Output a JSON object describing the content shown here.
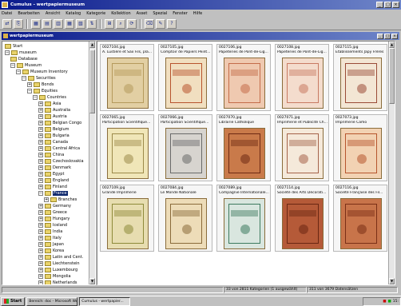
{
  "window": {
    "title": "Cumulus - wertpapiermuseum",
    "min": "_",
    "max": "□",
    "close": "×"
  },
  "menu": [
    "Datei",
    "Bearbeiten",
    "Ansicht",
    "Katalog",
    "Kategorie",
    "Kollektion",
    "Asset",
    "Spezial",
    "Fenster",
    "Hilfe"
  ],
  "toolbar": [
    "⇄",
    "⎘",
    "▦",
    "▤",
    "▥",
    "▦",
    "▧",
    "⇅",
    "⊞",
    "⌕",
    "⟳",
    "⌫",
    "✎",
    "?"
  ],
  "subwindow": {
    "title": "wertpapiermuseum"
  },
  "tree": [
    {
      "label": "Start",
      "depth": 0,
      "exp": ""
    },
    {
      "label": "museum",
      "depth": 0,
      "exp": "−"
    },
    {
      "label": "Database",
      "depth": 1,
      "exp": ""
    },
    {
      "label": "Museum",
      "depth": 1,
      "exp": "−"
    },
    {
      "label": "Museum Inventory",
      "depth": 2,
      "exp": "−"
    },
    {
      "label": "Securities",
      "depth": 3,
      "exp": "−"
    },
    {
      "label": "Bonds",
      "depth": 4,
      "exp": "+"
    },
    {
      "label": "Equities",
      "depth": 4,
      "exp": "−"
    },
    {
      "label": "Countries",
      "depth": 5,
      "exp": "−"
    },
    {
      "label": "Asia",
      "depth": 6,
      "exp": "+"
    },
    {
      "label": "Australia",
      "depth": 6,
      "exp": "+"
    },
    {
      "label": "Austria",
      "depth": 6,
      "exp": "+"
    },
    {
      "label": "Belgian Congo",
      "depth": 6,
      "exp": "+"
    },
    {
      "label": "Belgium",
      "depth": 6,
      "exp": "+"
    },
    {
      "label": "Bulgaria",
      "depth": 6,
      "exp": "+"
    },
    {
      "label": "Canada",
      "depth": 6,
      "exp": "+"
    },
    {
      "label": "Central Africa",
      "depth": 6,
      "exp": "+"
    },
    {
      "label": "China",
      "depth": 6,
      "exp": "+"
    },
    {
      "label": "Czechoslovakia",
      "depth": 6,
      "exp": "+"
    },
    {
      "label": "Denmark",
      "depth": 6,
      "exp": "+"
    },
    {
      "label": "Egypt",
      "depth": 6,
      "exp": "+"
    },
    {
      "label": "England",
      "depth": 6,
      "exp": "+"
    },
    {
      "label": "Finland",
      "depth": 6,
      "exp": "+"
    },
    {
      "label": "France",
      "depth": 6,
      "exp": "−",
      "selected": true
    },
    {
      "label": "Branches",
      "depth": 7,
      "exp": "+"
    },
    {
      "label": "Germany",
      "depth": 6,
      "exp": "+"
    },
    {
      "label": "Greece",
      "depth": 6,
      "exp": "+"
    },
    {
      "label": "Hungary",
      "depth": 6,
      "exp": "+"
    },
    {
      "label": "Iceland",
      "depth": 6,
      "exp": "+"
    },
    {
      "label": "India",
      "depth": 6,
      "exp": "+"
    },
    {
      "label": "Italy",
      "depth": 6,
      "exp": "+"
    },
    {
      "label": "Japan",
      "depth": 6,
      "exp": "+"
    },
    {
      "label": "Korea",
      "depth": 6,
      "exp": "+"
    },
    {
      "label": "Latin and Cent.",
      "depth": 6,
      "exp": "+"
    },
    {
      "label": "Liechtenstein",
      "depth": 6,
      "exp": "+"
    },
    {
      "label": "Luxembourg",
      "depth": 6,
      "exp": "+"
    },
    {
      "label": "Mongolia",
      "depth": 6,
      "exp": "+"
    },
    {
      "label": "Netherlands",
      "depth": 6,
      "exp": "+"
    }
  ],
  "assets": [
    {
      "name": "0027104.jpg",
      "desc": "A. Lustière et Sax Fils, pla...",
      "paper": "#e2cfa3",
      "ink": "#b59a5c"
    },
    {
      "name": "0027105.jpg",
      "desc": "Comptoir de Papiers Peint...",
      "paper": "#f1dfc0",
      "ink": "#b8542e"
    },
    {
      "name": "0027106.jpg",
      "desc": "Papeteries de Pont-de-Lig...",
      "paper": "#efc9b0",
      "ink": "#c46c4a"
    },
    {
      "name": "0027108.jpg",
      "desc": "Papeteries de Pont-de-Lig...",
      "paper": "#f4dccd",
      "ink": "#c87a63"
    },
    {
      "name": "0027115.jpg",
      "desc": "Etablissements Japy Frères",
      "paper": "#f3e6d4",
      "ink": "#9a4b37"
    },
    {
      "name": "0027065.jpg",
      "desc": "Participation Scientifique...",
      "paper": "#f0e6b8",
      "ink": "#9c8a4a"
    },
    {
      "name": "0027066.jpg",
      "desc": "Participation Scientifique...",
      "paper": "#d7d4cf",
      "ink": "#6a6a6a"
    },
    {
      "name": "0027070.jpg",
      "desc": "Librairie Catholique",
      "paper": "#c97a4a",
      "ink": "#6e2a14"
    },
    {
      "name": "0027071.jpg",
      "desc": "Imprimerie et Publicité Ch...",
      "paper": "#f5e9da",
      "ink": "#a5634a"
    },
    {
      "name": "0027073.jpg",
      "desc": "Imprimerie Camo",
      "paper": "#f2d2b3",
      "ink": "#b6552d"
    },
    {
      "name": "0027109.jpg",
      "desc": "Grande Imprimerie",
      "paper": "#e7ddb0",
      "ink": "#8e8a3a"
    },
    {
      "name": "0027084.jpg",
      "desc": "Le Monde Nationale",
      "paper": "#eddcb8",
      "ink": "#8a6b3a"
    },
    {
      "name": "0027089.jpg",
      "desc": "Compagnie Internationale...",
      "paper": "#d9e6df",
      "ink": "#3d7a5f"
    },
    {
      "name": "0027114.jpg",
      "desc": "Société des Arts Décorati...",
      "paper": "#b55a38",
      "ink": "#6a2713"
    },
    {
      "name": "0027116.jpg",
      "desc": "Société Française des Fil...",
      "paper": "#c8744a",
      "ink": "#7a2f16"
    }
  ],
  "status": {
    "count": "33 von 2811 Kategorien (1 ausgewählt)",
    "count2": "311 von 3679 Datensätzen"
  },
  "taskbar": {
    "start": "Start",
    "tasks": [
      "Bereich: doc - Microsoft Word",
      "Cumulus - wertpapier..."
    ],
    "clock": "15:"
  }
}
